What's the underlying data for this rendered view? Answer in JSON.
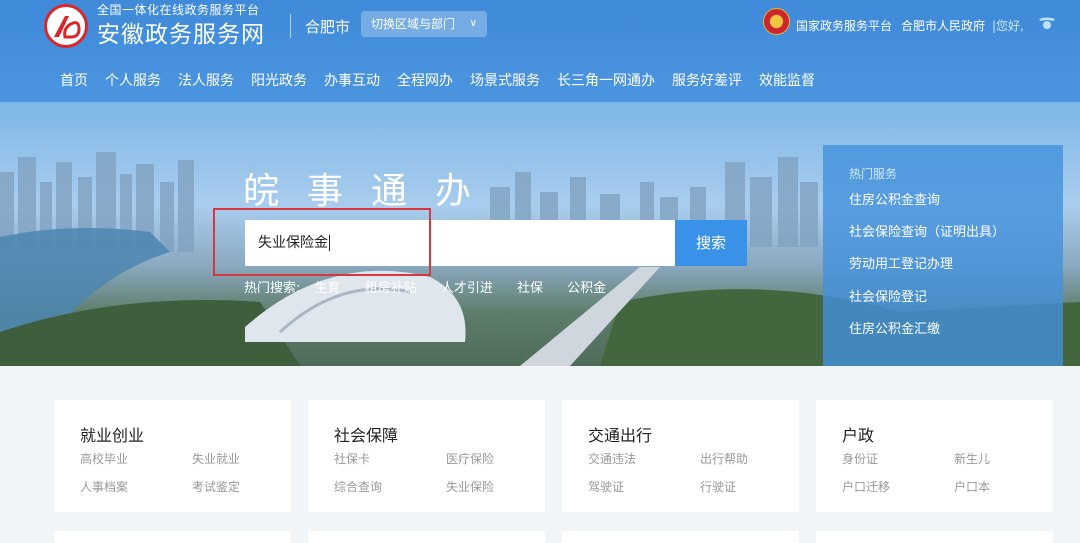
{
  "header": {
    "site_subtitle": "全国一体化在线政务服务平台",
    "site_title": "安徽政务服务网",
    "city": "合肥市",
    "region_button": "切换区域与部门",
    "gov_platform": "国家政务服务平台",
    "hefei_gov": "合肥市人民政府",
    "greeting": "|您好,"
  },
  "nav": [
    "首页",
    "个人服务",
    "法人服务",
    "阳光政务",
    "办事互动",
    "全程网办",
    "场景式服务",
    "长三角一网通办",
    "服务好差评",
    "效能监督"
  ],
  "hero": {
    "title": "皖事通办",
    "search_value": "失业保险金",
    "search_button": "搜索",
    "hot_search_label": "热门搜索:",
    "hot_search": [
      "生育",
      "租房补贴",
      "人才引进",
      "社保",
      "公积金"
    ]
  },
  "hot_services": {
    "title": "热门服务",
    "items": [
      "住房公积金查询",
      "社会保险查询（证明出具）",
      "劳动用工登记办理",
      "社会保险登记",
      "住房公积金汇缴"
    ]
  },
  "categories": [
    {
      "title": "就业创业",
      "links": [
        "高校毕业",
        "失业就业",
        "人事档案",
        "考试鉴定"
      ]
    },
    {
      "title": "社会保障",
      "links": [
        "社保卡",
        "医疗保险",
        "综合查询",
        "失业保险"
      ]
    },
    {
      "title": "交通出行",
      "links": [
        "交通违法",
        "出行帮助",
        "驾驶证",
        "行驶证"
      ]
    },
    {
      "title": "户政",
      "links": [
        "身份证",
        "新生儿",
        "户口迁移",
        "户口本"
      ]
    }
  ],
  "colors": {
    "header_blue": "#3f8ad9",
    "search_button": "#3a92e8",
    "highlight_red": "#d9363e"
  }
}
